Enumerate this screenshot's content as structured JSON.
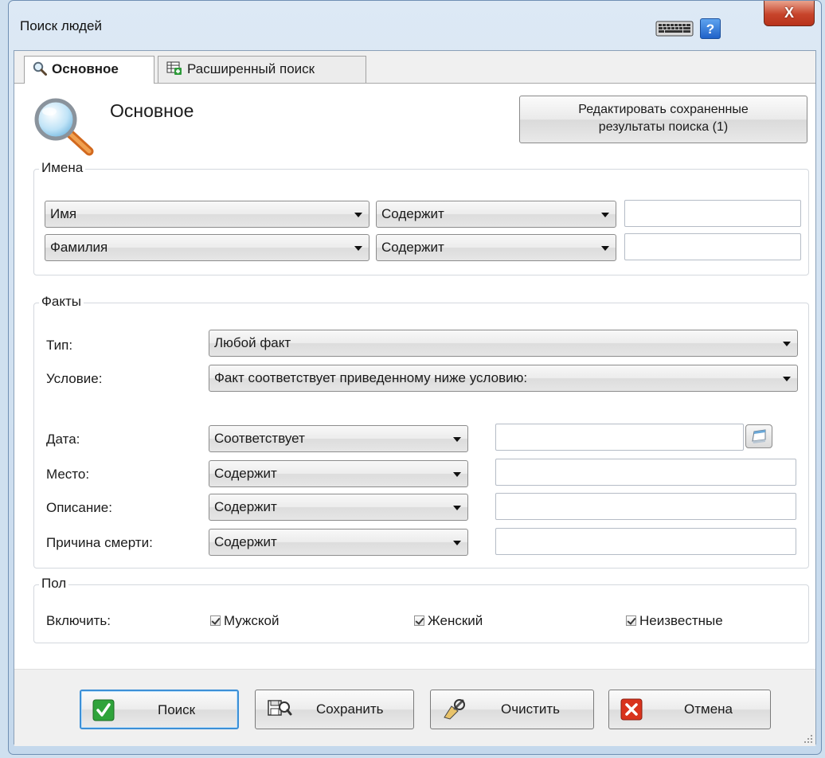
{
  "window": {
    "title": "Поиск людей",
    "help_label": "?",
    "close_label": "X"
  },
  "tabs": [
    {
      "label": "Основное",
      "active": true
    },
    {
      "label": "Расширенный поиск",
      "active": false
    }
  ],
  "header": {
    "heading": "Основное",
    "edit_saved_line1": "Редактировать сохраненные",
    "edit_saved_line2": "результаты поиска (1)"
  },
  "names": {
    "legend": "Имена",
    "rows": [
      {
        "field": "Имя",
        "condition": "Содержит",
        "value": ""
      },
      {
        "field": "Фамилия",
        "condition": "Содержит",
        "value": ""
      }
    ]
  },
  "facts": {
    "legend": "Факты",
    "type_label": "Тип:",
    "type_value": "Любой факт",
    "condition_label": "Условие:",
    "condition_value": "Факт соответствует приведенному ниже условию:",
    "rows": [
      {
        "label": "Дата:",
        "condition": "Соответствует",
        "value": ""
      },
      {
        "label": "Место:",
        "condition": "Содержит",
        "value": ""
      },
      {
        "label": "Описание:",
        "condition": "Содержит",
        "value": ""
      },
      {
        "label": "Причина смерти:",
        "condition": "Содержит",
        "value": ""
      }
    ]
  },
  "gender": {
    "legend": "Пол",
    "include_label": "Включить:",
    "options": [
      {
        "label": "Мужской",
        "checked": true
      },
      {
        "label": "Женский",
        "checked": true
      },
      {
        "label": "Неизвестные",
        "checked": true
      }
    ]
  },
  "footer": {
    "search": "Поиск",
    "save": "Сохранить",
    "clear": "Очистить",
    "cancel": "Отмена"
  },
  "colors": {
    "accent": "#3c8fd6",
    "ok_green": "#2fa33a",
    "cancel_red": "#d9331d",
    "close_red": "#c7442b"
  }
}
